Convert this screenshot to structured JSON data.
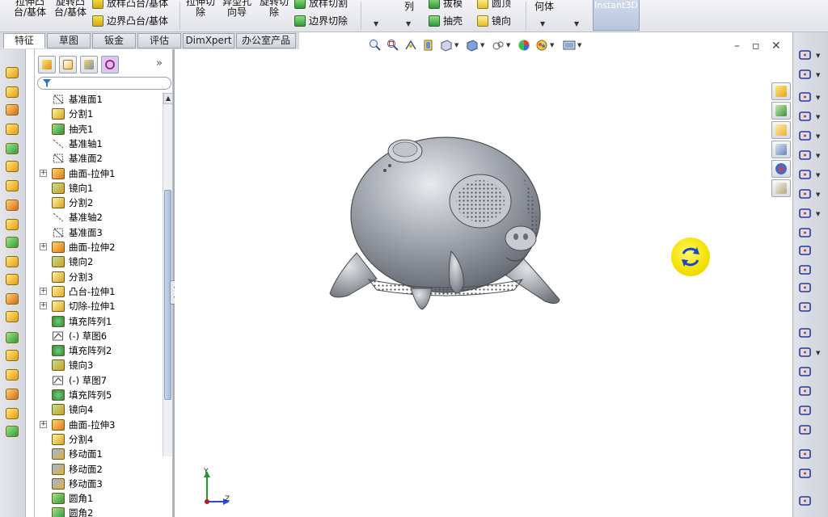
{
  "ribbon": {
    "extrude_boss": "拉伸凸\n台/基体",
    "revolve_boss": "旋转凸\n台/基体",
    "loft_boss": "放样凸台/基体",
    "boundary_boss": "边界凸台/基体",
    "extrude_cut": "拉伸切\n除",
    "hole_wizard": "异型孔\n向导",
    "revolve_cut": "旋转切\n除",
    "loft_cut": "放样切割",
    "boundary_cut": "边界切除",
    "pattern": "列",
    "draft": "拔模",
    "shell": "抽壳",
    "dome": "圆顶",
    "mirror": "镜向",
    "ref_geometry": "何体",
    "instant3d": "Instant3D"
  },
  "tabs": [
    {
      "label": "特征",
      "active": true
    },
    {
      "label": "草图",
      "active": false
    },
    {
      "label": "钣金",
      "active": false
    },
    {
      "label": "评估",
      "active": false
    },
    {
      "label": "DimXpert",
      "active": false
    },
    {
      "label": "办公室产品",
      "active": false
    }
  ],
  "feature_manager": {
    "expand_glyph": "»",
    "tree": [
      {
        "label": "基准面1",
        "icon": "plane-icon",
        "expandable": false
      },
      {
        "label": "分割1",
        "icon": "split-icon",
        "expandable": false
      },
      {
        "label": "抽壳1",
        "icon": "shell-icon",
        "expandable": false
      },
      {
        "label": "基准轴1",
        "icon": "axis-icon",
        "expandable": false
      },
      {
        "label": "基准面2",
        "icon": "plane-icon",
        "expandable": false
      },
      {
        "label": "曲面-拉伸1",
        "icon": "surface-extrude-icon",
        "expandable": true
      },
      {
        "label": "镜向1",
        "icon": "mirror-icon",
        "expandable": false
      },
      {
        "label": "分割2",
        "icon": "split-icon",
        "expandable": false
      },
      {
        "label": "基准轴2",
        "icon": "axis-icon",
        "expandable": false
      },
      {
        "label": "基准面3",
        "icon": "plane-icon",
        "expandable": false
      },
      {
        "label": "曲面-拉伸2",
        "icon": "surface-extrude-icon",
        "expandable": true
      },
      {
        "label": "镜向2",
        "icon": "mirror-icon",
        "expandable": false
      },
      {
        "label": "分割3",
        "icon": "split-icon",
        "expandable": false
      },
      {
        "label": "凸台-拉伸1",
        "icon": "boss-extrude-icon",
        "expandable": true
      },
      {
        "label": "切除-拉伸1",
        "icon": "cut-extrude-icon",
        "expandable": true
      },
      {
        "label": "填充阵列1",
        "icon": "fill-pattern-icon",
        "expandable": false
      },
      {
        "label": "(-) 草图6",
        "icon": "sketch-icon",
        "expandable": false
      },
      {
        "label": "填充阵列2",
        "icon": "fill-pattern-icon",
        "expandable": false
      },
      {
        "label": "镜向3",
        "icon": "mirror-icon",
        "expandable": false
      },
      {
        "label": "(-) 草图7",
        "icon": "sketch-icon",
        "expandable": false
      },
      {
        "label": "填充阵列5",
        "icon": "fill-pattern-icon",
        "expandable": false
      },
      {
        "label": "镜向4",
        "icon": "mirror-icon",
        "expandable": false
      },
      {
        "label": "曲面-拉伸3",
        "icon": "surface-extrude-icon",
        "expandable": true
      },
      {
        "label": "分割4",
        "icon": "split-icon",
        "expandable": false
      },
      {
        "label": "移动面1",
        "icon": "move-face-icon",
        "expandable": false
      },
      {
        "label": "移动面2",
        "icon": "move-face-icon",
        "expandable": false
      },
      {
        "label": "移动面3",
        "icon": "move-face-icon",
        "expandable": false
      },
      {
        "label": "圆角1",
        "icon": "fillet-icon",
        "expandable": false
      },
      {
        "label": "圆角2",
        "icon": "fillet-icon",
        "expandable": false
      }
    ]
  },
  "graphics": {
    "triad_y": "Y",
    "triad_z": "Z",
    "window_controls": {
      "minimize": "–",
      "restore": "▫",
      "close": "✕"
    }
  },
  "colors": {
    "accent": "#f2e100",
    "model": "#8f939c",
    "tab_bg": "#d8dbe2"
  }
}
